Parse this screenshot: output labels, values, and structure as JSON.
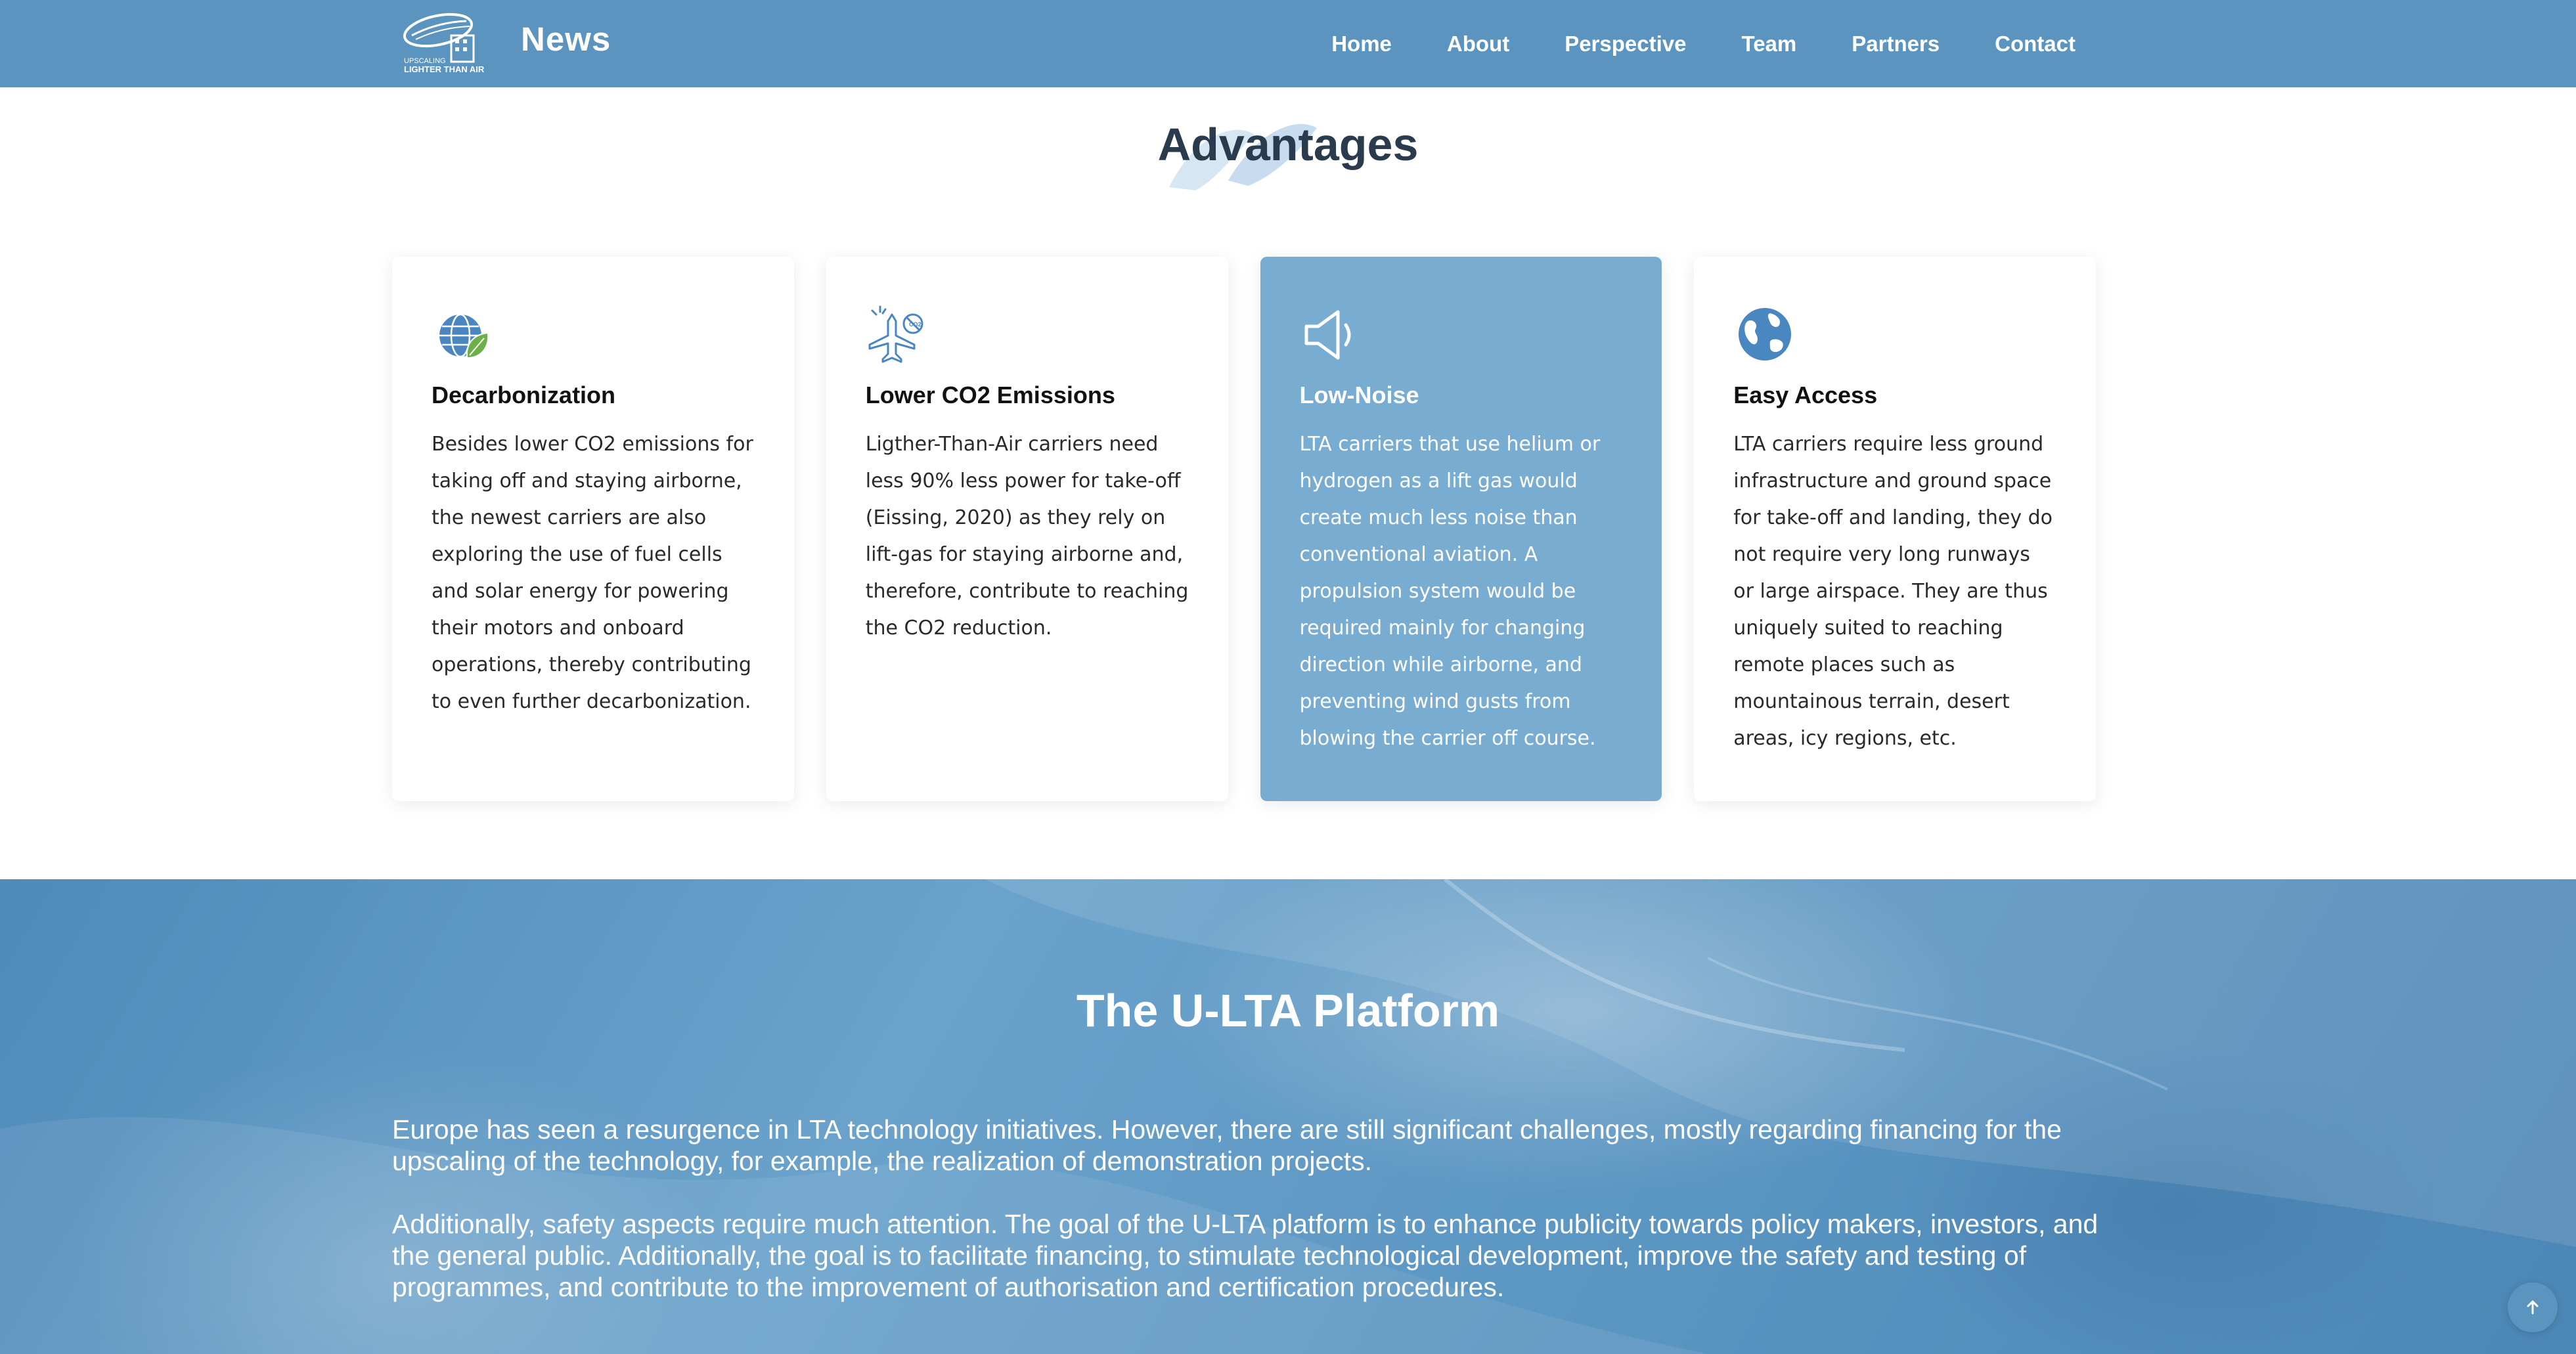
{
  "header": {
    "logo_text": "UPSCALING LIGHTER THAN AIR",
    "brand": "News",
    "nav": [
      "Home",
      "About",
      "Perspective",
      "Team",
      "Partners",
      "Contact"
    ]
  },
  "advantages": {
    "title": "Advantages",
    "cards": [
      {
        "icon": "globe-leaf-icon",
        "title": "Decarbonization",
        "text": "Besides lower CO2 emissions for taking off and staying airborne, the newest carriers are also exploring the use of fuel cells and solar energy for powering their motors and onboard operations, thereby contributing to even further decarbonization."
      },
      {
        "icon": "plane-co2-icon",
        "title": "Lower CO2 Emissions",
        "text": "Ligther-Than-Air carriers need less 90% less power for take-off (Eissing, 2020) as they rely on lift-gas for staying airborne and, therefore, contribute to reaching the CO2 reduction."
      },
      {
        "icon": "speaker-icon",
        "title": "Low-Noise",
        "text": "LTA carriers that use helium or hydrogen as a lift gas would create much less noise than conventional aviation. A propulsion system would be required mainly for changing direction while airborne, and preventing wind gusts from blowing the carrier off course."
      },
      {
        "icon": "globe-icon",
        "title": "Easy Access",
        "text": "LTA carriers require less ground infrastructure and ground space for take-off and landing, they do not require very long runways or large airspace. They are thus uniquely suited to reaching remote places such as mountainous terrain, desert areas, icy regions, etc."
      }
    ]
  },
  "platform": {
    "title": "The U-LTA Platform",
    "paragraph1": "Europe has seen a resurgence in LTA technology initiatives. However, there are still significant challenges, mostly regarding financing for the upscaling of the technology, for example, the realization of demonstration projects.",
    "paragraph2": "Additionally, safety aspects require much attention. The goal of the U-LTA platform is to enhance publicity towards policy makers, investors, and the general public. Additionally, the goal is to facilitate financing, to stimulate technological development, improve the safety and testing of programmes, and contribute to the improvement of authorisation and certification procedures."
  },
  "colors": {
    "header": "#5b95bf",
    "accent_card": "#78acd1",
    "icon_blue": "#4a86c0",
    "leaf_green": "#6cb04a"
  }
}
